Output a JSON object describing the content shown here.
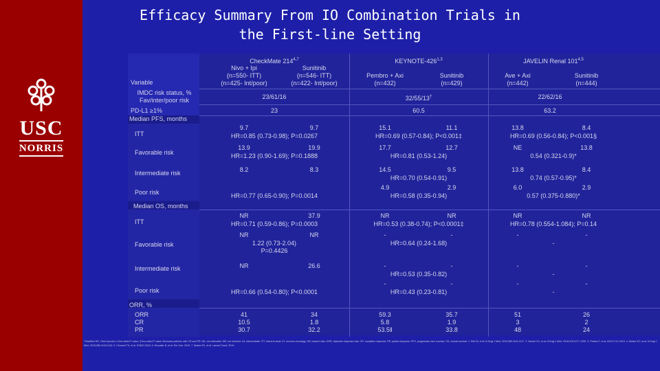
{
  "title": "Efficacy Summary From IO Combination Trials in the First-line Setting",
  "logo": {
    "name": "USC",
    "sub": "NORRIS"
  },
  "header": {
    "variable_label": "Variable",
    "trials": [
      {
        "name": "CheckMate 214",
        "refs": "4,7",
        "arms": [
          {
            "label": "Nivo + Ipi",
            "n": "(n=550- ITT)",
            "n2": "(n=425- Int/poor)"
          },
          {
            "label": "Sunitinib",
            "n": "(n=546- ITT)",
            "n2": "(n=422- Int/poor)"
          }
        ]
      },
      {
        "name": "KEYNOTE-426",
        "refs": "1,3",
        "arms": [
          {
            "label": "Pembro + Axi",
            "n": "(n=432)"
          },
          {
            "label": "Sunitinib",
            "n": "(n=429)"
          }
        ]
      },
      {
        "name": "JAVELIN Renal 101",
        "refs": "4,5",
        "arms": [
          {
            "label": "Ave + Axi",
            "n": "(n=442)"
          },
          {
            "label": "Sunitinib",
            "n": "(n=444)"
          }
        ]
      }
    ]
  },
  "rows": {
    "imdc": {
      "label": "IMDC risk status, % Fav/inter/poor risk",
      "values": [
        "23/61/16",
        "32/55/13",
        "22/62/16"
      ],
      "mark2": "†"
    },
    "pdl1": {
      "label": "PD-L1 ≥1%",
      "values": [
        "23",
        "60.5",
        "63.2"
      ]
    }
  },
  "pfs": {
    "section": "Median PFS, months",
    "rows": [
      {
        "label": "ITT",
        "cm": [
          "9.7",
          "9.7",
          "HR=0.85 (0.73-0.98); P=0.0267"
        ],
        "kn": [
          "15.1",
          "11.1",
          "HR=0.69 (0.57-0.84); P<0.001‡"
        ],
        "jv": [
          "13.8",
          "8.4",
          "HR=0.69 (0.56-0.84); P<0.001§"
        ]
      },
      {
        "label": "Favorable risk",
        "cm": [
          "13.9",
          "19.9",
          "HR=1.23 (0.90-1.69); P=0.1888"
        ],
        "kn": [
          "17.7",
          "12.7",
          "HR=0.81 (0.53-1.24)"
        ],
        "jv": [
          "NE",
          "13.8",
          "0.54 (0.321-0.9)*"
        ]
      },
      {
        "label": "Intermediate risk",
        "cm": [
          "8.2",
          "8.3",
          ""
        ],
        "kn": [
          "14.5",
          "9.5",
          "HR=0.70 (0.54-0.91)"
        ],
        "jv": [
          "13.8",
          "8.4",
          "0.74 (0.57-0.95)*"
        ]
      },
      {
        "label": "Poor risk",
        "cm": [
          "",
          "",
          "HR=0.77 (0.65-0.90); P=0.0014"
        ],
        "kn": [
          "4.9",
          "2.9",
          "HR=0.58 (0.35-0.94)"
        ],
        "jv": [
          "6.0",
          "2.9",
          "0.57 (0.375-0.880)*"
        ]
      }
    ]
  },
  "os": {
    "section": "Median OS, months",
    "rows": [
      {
        "label": "ITT",
        "cm": [
          "NR",
          "37.9",
          "HR=0.71 (0.59-0.86); P=0.0003"
        ],
        "kn": [
          "NR",
          "NR",
          "HR=0.53 (0.38-0.74); P<0.0001‡"
        ],
        "jv": [
          "NR",
          "NR",
          "HR=0.78 (0.554-1.084); P=0.14"
        ]
      },
      {
        "label": "Favorable risk",
        "cm": [
          "NR",
          "NR",
          "1.22 (0.73-2.04)",
          "P=0.4426"
        ],
        "kn": [
          "-",
          "-",
          "HR=0.64 (0.24-1.68)"
        ],
        "jv": [
          "-",
          "-",
          "-"
        ]
      },
      {
        "label": "Intermediate risk",
        "cm": [
          "NR",
          "26.6",
          ""
        ],
        "kn": [
          "-",
          "-",
          "HR=0.53 (0.35-0.82)"
        ],
        "jv": [
          "-",
          "-",
          "-"
        ]
      },
      {
        "label": "Poor risk",
        "cm": [
          "",
          "",
          "HR=0.66 (0.54-0.80); P<0.0001"
        ],
        "kn": [
          "-",
          "-",
          "HR=0.43 (0.23-0.81)"
        ],
        "jv": [
          "-",
          "-",
          "-"
        ]
      }
    ]
  },
  "orr": {
    "section": "ORR, %",
    "rows": [
      {
        "label": "ORR",
        "values": [
          "41",
          "34",
          "59.3",
          "35.7",
          "51",
          "26"
        ]
      },
      {
        "label": "CR",
        "values": [
          "10.5",
          "1.8",
          "5.8",
          "1.9",
          "3",
          "2"
        ]
      },
      {
        "label": "PR",
        "values": [
          "30.7",
          "32.2",
          "53.5‖",
          "33.8",
          "48",
          "24"
        ]
      }
    ]
  },
  "footnote": "*Stratified HR; †Not reported; ‡One-sided P value; §Two-sided P value; ‖Includes patients with CR and PR. NE, not estimable; NR, not reached. Int, intermediate; ITT, intent-to-treat; IO, immuno-oncology; HR, hazard ratio; ORR, objective response rate; CR, complete response; PR, partial response; PFS, progression-free survival; OS, overall survival. 1. Rini BI, et al. N Engl J Med. 2019;380:1116-1127. 2. Motzer RJ, et al. N Engl J Med. 2018;378:1277-1290. 3. Powles T, et al. ASCO GU 2019. 4. Motzer RJ, et al. N Engl J Med. 2019;380:1103-1115. 5. Choueiri TK, et al. ESMO 2018. 6. Escudier B, et al. Eur Urol. 2019. 7. Motzer RJ, et al. Lancet Oncol. 2019."
}
